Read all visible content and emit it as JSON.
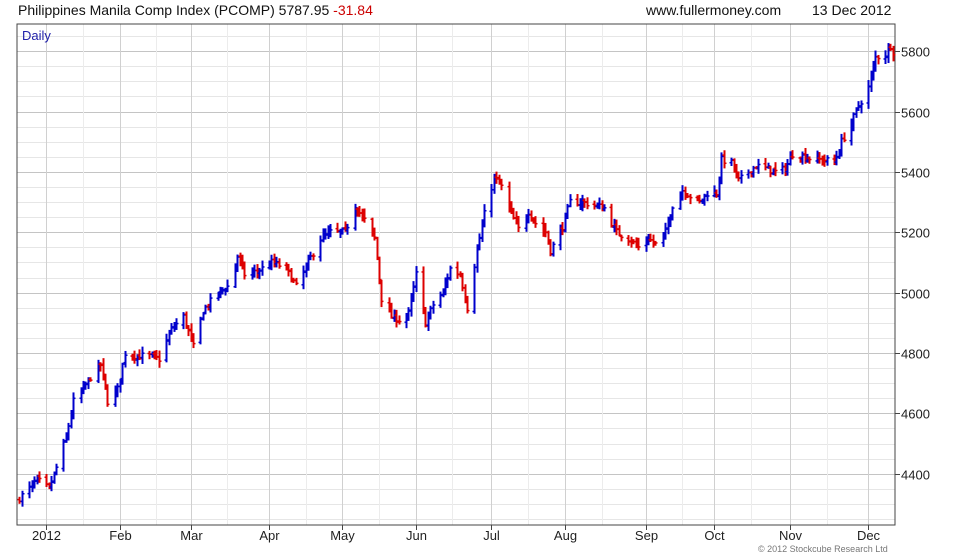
{
  "header": {
    "title": "Philippines Manila Comp Index (PCOMP)",
    "last": "5787.95",
    "change": "-31.84",
    "site": "www.fullermoney.com",
    "date": "13 Dec 2012"
  },
  "footer": {
    "copyright": "© 2012 Stockcube Research Ltd"
  },
  "colors": {
    "up": "#0000cc",
    "down": "#dd0000",
    "grid": "#d4d4d4",
    "frame": "#444444",
    "period": "#2222aa"
  },
  "chart_data": {
    "type": "ohlc",
    "title": "",
    "period_label": "Daily",
    "xlabel": "",
    "ylabel": "",
    "ylim": [
      4230,
      5890
    ],
    "grid": true,
    "x_range": [
      "2011-12-21",
      "2012-12-14"
    ],
    "y_ticks": [
      4400,
      4600,
      4800,
      5000,
      5200,
      5400,
      5600,
      5800
    ],
    "x_ticks": [
      {
        "label": "2012",
        "date": "2012-01-02"
      },
      {
        "label": "Feb",
        "date": "2012-02-01"
      },
      {
        "label": "Mar",
        "date": "2012-03-01"
      },
      {
        "label": "Apr",
        "date": "2012-04-02"
      },
      {
        "label": "May",
        "date": "2012-05-02"
      },
      {
        "label": "Jun",
        "date": "2012-06-01"
      },
      {
        "label": "Jul",
        "date": "2012-07-02"
      },
      {
        "label": "Aug",
        "date": "2012-08-01"
      },
      {
        "label": "Sep",
        "date": "2012-09-03"
      },
      {
        "label": "Oct",
        "date": "2012-10-01"
      },
      {
        "label": "Nov",
        "date": "2012-11-01"
      },
      {
        "label": "Dec",
        "date": "2012-12-03"
      }
    ],
    "anchors": [
      [
        "2011-12-22",
        4320
      ],
      [
        "2011-12-27",
        4360
      ],
      [
        "2011-12-29",
        4380
      ],
      [
        "2012-01-03",
        4350
      ],
      [
        "2012-01-06",
        4420
      ],
      [
        "2012-01-10",
        4520
      ],
      [
        "2012-01-13",
        4640
      ],
      [
        "2012-01-17",
        4680
      ],
      [
        "2012-01-20",
        4720
      ],
      [
        "2012-01-24",
        4760
      ],
      [
        "2012-01-27",
        4640
      ],
      [
        "2012-01-31",
        4680
      ],
      [
        "2012-02-03",
        4800
      ],
      [
        "2012-02-08",
        4790
      ],
      [
        "2012-02-13",
        4790
      ],
      [
        "2012-02-17",
        4780
      ],
      [
        "2012-02-22",
        4880
      ],
      [
        "2012-02-27",
        4920
      ],
      [
        "2012-03-02",
        4820
      ],
      [
        "2012-03-06",
        4940
      ],
      [
        "2012-03-12",
        5000
      ],
      [
        "2012-03-16",
        5020
      ],
      [
        "2012-03-20",
        5120
      ],
      [
        "2012-03-23",
        5060
      ],
      [
        "2012-03-28",
        5070
      ],
      [
        "2012-04-03",
        5100
      ],
      [
        "2012-04-09",
        5080
      ],
      [
        "2012-04-13",
        5020
      ],
      [
        "2012-04-18",
        5100
      ],
      [
        "2012-04-23",
        5180
      ],
      [
        "2012-04-27",
        5200
      ],
      [
        "2012-05-03",
        5200
      ],
      [
        "2012-05-07",
        5290
      ],
      [
        "2012-05-11",
        5240
      ],
      [
        "2012-05-15",
        5180
      ],
      [
        "2012-05-18",
        4980
      ],
      [
        "2012-05-22",
        4920
      ],
      [
        "2012-05-25",
        4910
      ],
      [
        "2012-05-29",
        4930
      ],
      [
        "2012-06-01",
        5060
      ],
      [
        "2012-06-05",
        4900
      ],
      [
        "2012-06-08",
        4960
      ],
      [
        "2012-06-12",
        5000
      ],
      [
        "2012-06-15",
        5080
      ],
      [
        "2012-06-19",
        5060
      ],
      [
        "2012-06-22",
        4950
      ],
      [
        "2012-06-26",
        5140
      ],
      [
        "2012-06-29",
        5260
      ],
      [
        "2012-07-03",
        5380
      ],
      [
        "2012-07-06",
        5350
      ],
      [
        "2012-07-10",
        5260
      ],
      [
        "2012-07-13",
        5210
      ],
      [
        "2012-07-17",
        5270
      ],
      [
        "2012-07-20",
        5230
      ],
      [
        "2012-07-24",
        5200
      ],
      [
        "2012-07-26",
        5140
      ],
      [
        "2012-07-31",
        5220
      ],
      [
        "2012-08-03",
        5300
      ],
      [
        "2012-08-08",
        5300
      ],
      [
        "2012-08-13",
        5290
      ],
      [
        "2012-08-17",
        5280
      ],
      [
        "2012-08-22",
        5200
      ],
      [
        "2012-08-27",
        5180
      ],
      [
        "2012-08-31",
        5150
      ],
      [
        "2012-09-04",
        5180
      ],
      [
        "2012-09-07",
        5160
      ],
      [
        "2012-09-11",
        5200
      ],
      [
        "2012-09-14",
        5290
      ],
      [
        "2012-09-18",
        5340
      ],
      [
        "2012-09-21",
        5320
      ],
      [
        "2012-09-25",
        5300
      ],
      [
        "2012-09-28",
        5330
      ],
      [
        "2012-10-02",
        5330
      ],
      [
        "2012-10-04",
        5440
      ],
      [
        "2012-10-08",
        5430
      ],
      [
        "2012-10-11",
        5370
      ],
      [
        "2012-10-15",
        5400
      ],
      [
        "2012-10-18",
        5420
      ],
      [
        "2012-10-23",
        5410
      ],
      [
        "2012-10-26",
        5400
      ],
      [
        "2012-10-30",
        5410
      ],
      [
        "2012-11-02",
        5460
      ],
      [
        "2012-11-07",
        5450
      ],
      [
        "2012-11-12",
        5440
      ],
      [
        "2012-11-15",
        5440
      ],
      [
        "2012-11-19",
        5430
      ],
      [
        "2012-11-22",
        5500
      ],
      [
        "2012-11-26",
        5560
      ],
      [
        "2012-11-29",
        5620
      ],
      [
        "2012-12-03",
        5680
      ],
      [
        "2012-12-06",
        5780
      ],
      [
        "2012-12-10",
        5790
      ],
      [
        "2012-12-12",
        5820
      ],
      [
        "2012-12-13",
        5787.95
      ]
    ]
  }
}
